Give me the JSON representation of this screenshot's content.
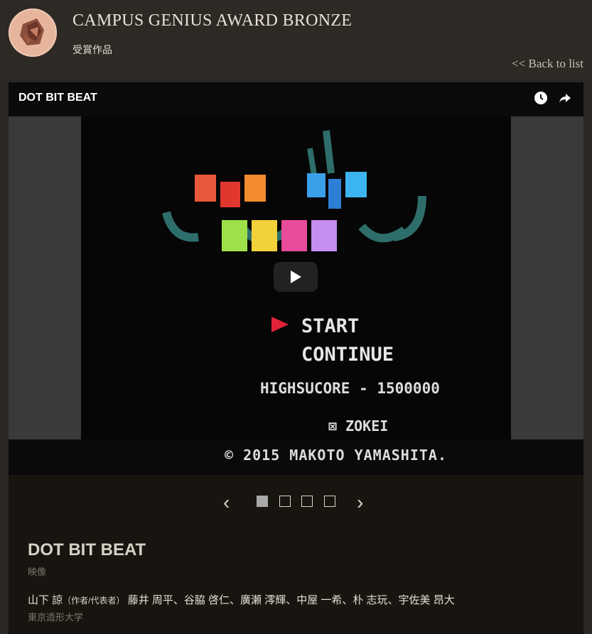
{
  "header": {
    "title": "CAMPUS GENIUS AWARD BRONZE",
    "subtitle": "受賞作品",
    "back_link": "<< Back to list"
  },
  "video": {
    "title": "DOT BIT BEAT",
    "icons": [
      "clock-icon",
      "share-icon",
      "play-icon"
    ],
    "game_text": {
      "start": "START",
      "continue": "CONTINUE",
      "highscore": "HIGHSUCORE - 1500000",
      "zokei": "⊠ ZOKEI",
      "copyright": "© 2015  MAKOTO YAMASHITA."
    }
  },
  "carousel": {
    "prev": "‹",
    "next": "›",
    "slide_count": 4,
    "active_slide": 1
  },
  "work": {
    "title": "DOT BIT BEAT",
    "category": "映像",
    "author": "山下 諒",
    "role": "（作者/代表者）",
    "members": "藤井 周平、谷脇 啓仁、廣瀬 澪輝、中屋 一希、朴 志玩、宇佐美 昂大",
    "school": "東京造形大学"
  },
  "colors": {
    "background": "#2b2722",
    "panel": "#181510",
    "logo": "#e7b49c",
    "active_dot": "#a8a8a8"
  }
}
